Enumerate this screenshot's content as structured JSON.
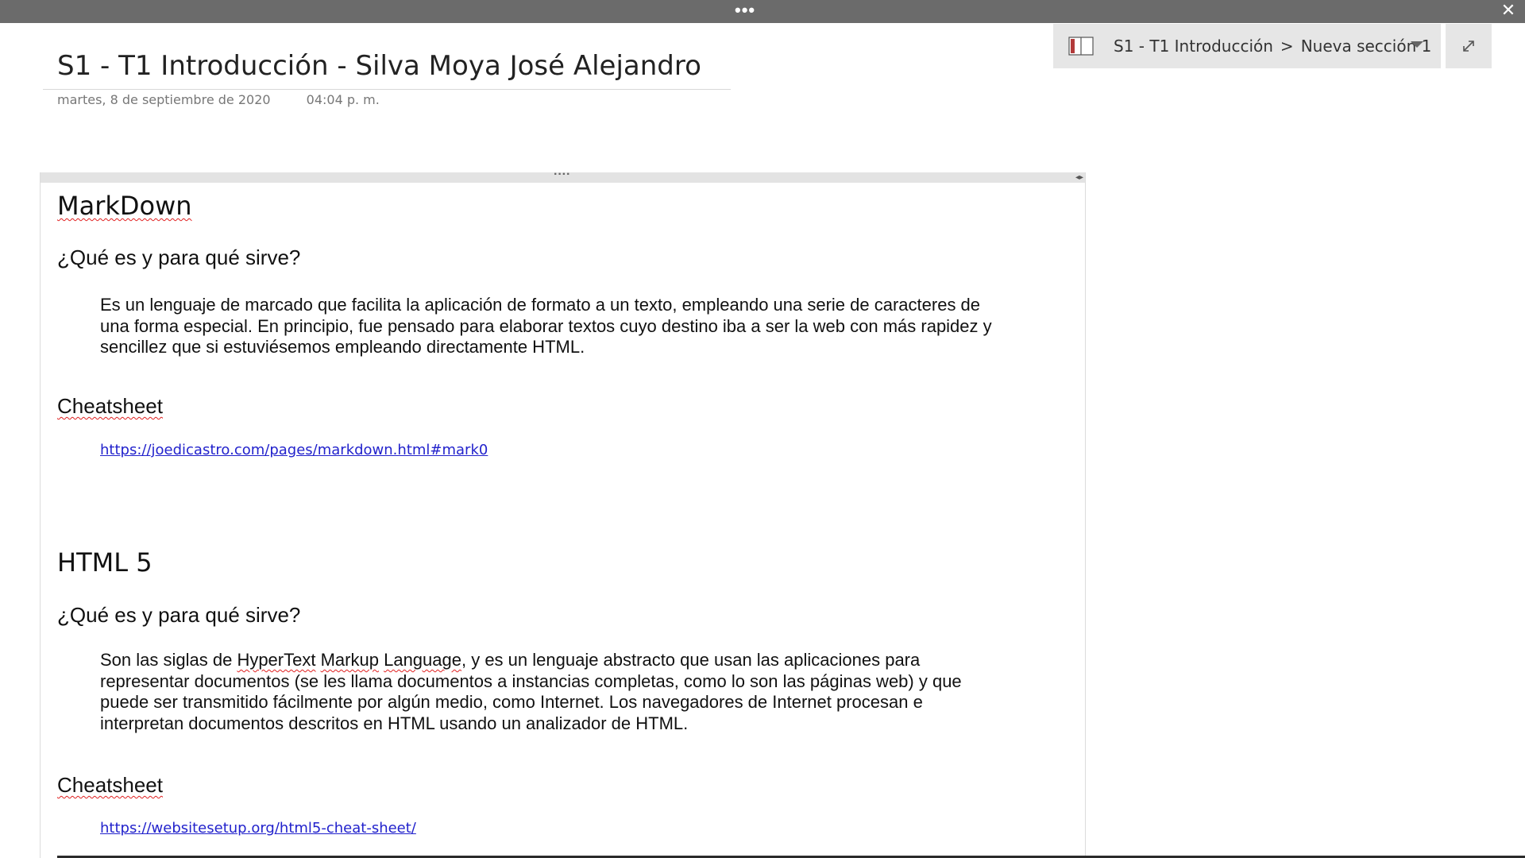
{
  "topbar": {
    "dots": "•••",
    "close": "✕"
  },
  "page": {
    "title": "S1 - T1 Introducción - Silva Moya José Alejandro",
    "date": "martes, 8 de septiembre de 2020",
    "time": "04:04 p. m."
  },
  "breadcrumb": {
    "notebook": "S1 - T1 Introducción",
    "separator": ">",
    "section": "Nueva sección 1"
  },
  "note": {
    "grip": "····",
    "resize": "◂▸",
    "sections": [
      {
        "heading": "MarkDown",
        "subheading": "¿Qué es y para qué sirve?",
        "body_lines": [
          "Es un lenguaje de marcado que facilita la aplicación de formato a un texto, empleando una serie de caracteres de",
          "una forma especial. En principio, fue pensado para elaborar textos cuyo destino iba a ser la web con más rapidez y",
          "sencillez que si estuviésemos empleando directamente HTML."
        ],
        "cheatsheet_label": "Cheatsheet",
        "link": "https://joedicastro.com/pages/markdown.html#mark0"
      },
      {
        "heading": "HTML 5",
        "subheading": "¿Qué es y para qué sirve?",
        "body_line1_pre": "Son las siglas de ",
        "body_line1_w1": "HyperText",
        "body_line1_w2": "Markup",
        "body_line1_w3": "Language",
        "body_line1_post": ", y es un lenguaje abstracto que usan las aplicaciones para",
        "body_lines": [
          "representar documentos (se les llama documentos a instancias completas, como lo son las páginas web) y que",
          "puede ser transmitido fácilmente por algún medio, como Internet. Los navegadores de Internet procesan e",
          "interpretan documentos descritos en HTML usando un analizador de HTML."
        ],
        "cheatsheet_label": "Cheatsheet",
        "link": "https://websitesetup.org/html5-cheat-sheet/"
      }
    ]
  },
  "colors": {
    "topbar": "#6b6b6b",
    "panel": "#e6e6e6",
    "link": "#2222cc",
    "spellcheck": "#e02020"
  },
  "icons": {
    "topbar_menu": "more-dots-icon",
    "close": "close-icon",
    "notebook": "notebook-icon",
    "caret": "chevron-down-icon",
    "expand": "expand-icon"
  }
}
